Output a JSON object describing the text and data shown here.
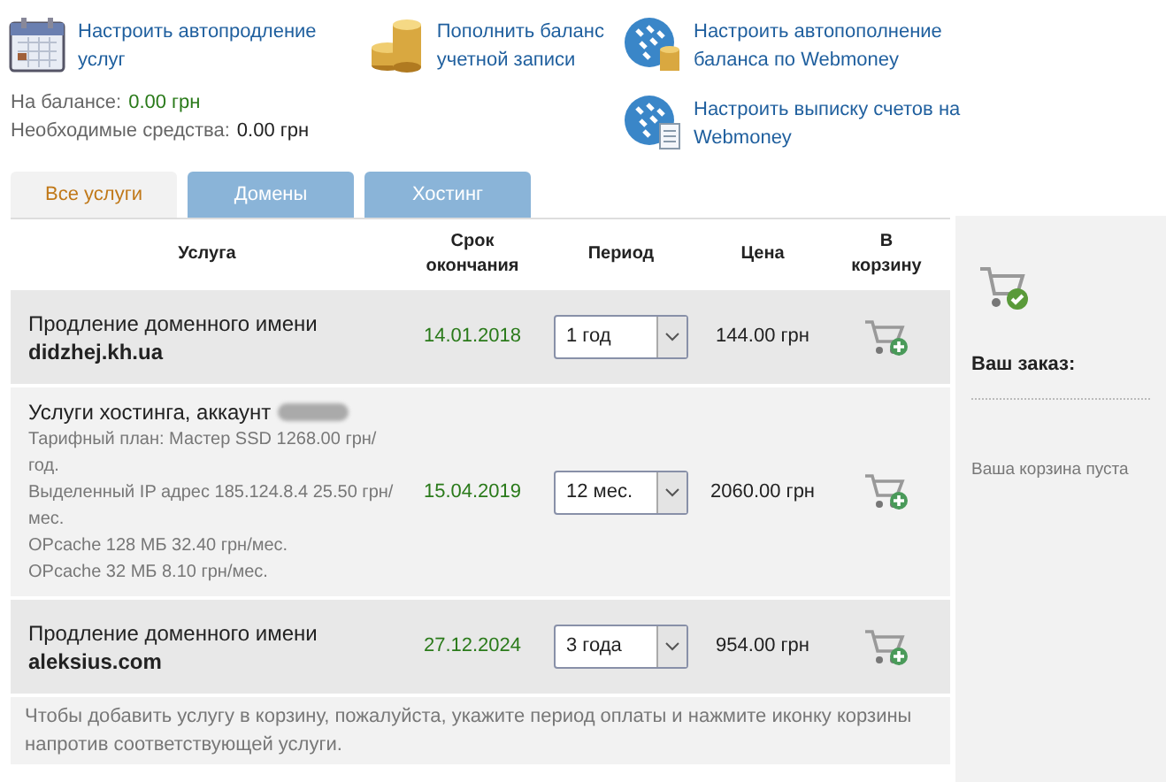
{
  "top_links": [
    {
      "text": "Настроить автопродление услуг"
    },
    {
      "text": "Пополнить баланс учетной записи"
    },
    {
      "text": "Настроить автопополнение баланса по Webmoney"
    },
    {
      "text": "Настроить выписку счетов на Webmoney"
    }
  ],
  "balance": {
    "label": "На балансе:",
    "value": "0.00 грн"
  },
  "required_funds": {
    "label": "Необходимые средства:",
    "value": "0.00 грн"
  },
  "tabs": [
    {
      "label": "Все услуги",
      "selected": true
    },
    {
      "label": "Домены",
      "selected": false
    },
    {
      "label": "Хостинг",
      "selected": false
    }
  ],
  "table": {
    "columns": [
      "Услуга",
      "Срок окончания",
      "Период",
      "Цена",
      "В корзину"
    ],
    "rows": [
      {
        "title": "Продление доменного имени",
        "name": "didzhej.kh.ua",
        "details": [],
        "expiry": "14.01.2018",
        "period": "1 год",
        "price": "144.00 грн"
      },
      {
        "title": "Услуги хостинга, аккаунт",
        "redacted": true,
        "details": [
          "Тарифный план: Мастер SSD 1268.00 грн/год.",
          "Выделенный IP адрес 185.124.8.4 25.50 грн/мес.",
          "OPcache 128 МБ 32.40 грн/мес.",
          "OPcache 32 МБ 8.10 грн/мес."
        ],
        "expiry": "15.04.2019",
        "period": "12 мес.",
        "price": "2060.00 грн"
      },
      {
        "title": "Продление доменного имени",
        "name": "aleksius.com",
        "details": [],
        "expiry": "27.12.2024",
        "period": "3 года",
        "price": "954.00 грн"
      }
    ]
  },
  "note": "Чтобы добавить услугу в корзину, пожалуйста, укажите период оплаты и нажмите иконку корзины напротив соответствующей услуги.",
  "order": {
    "title": "Ваш заказ:",
    "empty_text": "Ваша корзина пуста"
  }
}
